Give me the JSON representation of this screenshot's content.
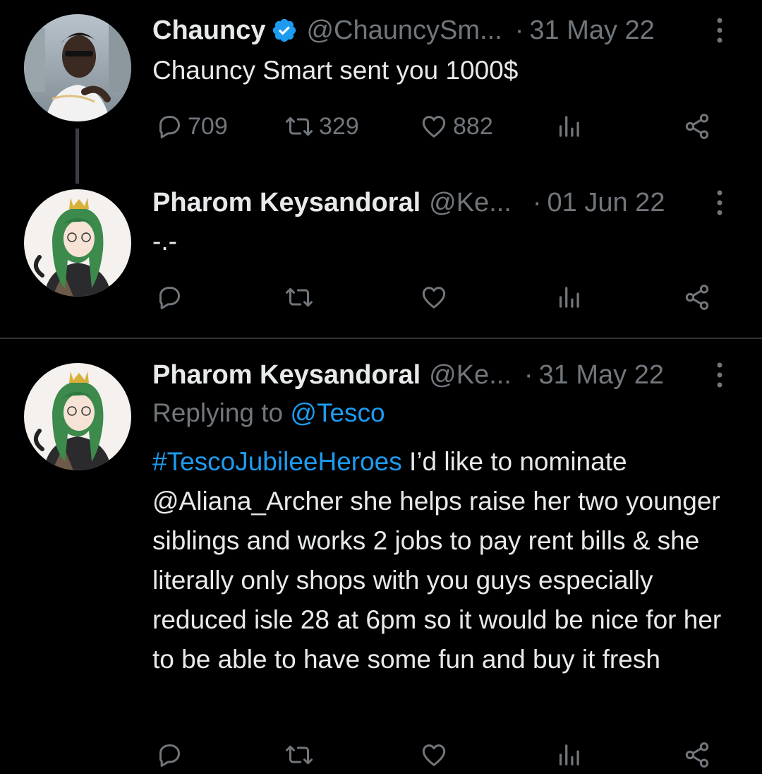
{
  "tweets": [
    {
      "name": "Chauncy",
      "verified": true,
      "handle": "@ChauncySm...",
      "date": "31 May 22",
      "text": "Chauncy Smart sent you 1000$",
      "replies": "709",
      "retweets": "329",
      "likes": "882"
    },
    {
      "name": "Pharom Keysandoral",
      "verified": false,
      "handle": "@Ke...",
      "date": "01 Jun 22",
      "text": "-.-",
      "replies": "",
      "retweets": "",
      "likes": ""
    },
    {
      "name": "Pharom Keysandoral",
      "verified": false,
      "handle": "@Ke...",
      "date": "31 May 22",
      "replying_prefix": "Replying to",
      "replying_to": "@Tesco",
      "hashtag": "#TescoJubileeHeroes",
      "text": " I’d like to nominate @Aliana_Archer she helps raise her two younger siblings and works 2 jobs to pay rent bills & she literally only shops with you guys especially reduced isle 28 at 6pm so it would be nice for her to be able to have some fun and buy it fresh"
    }
  ],
  "dot_separator": "·",
  "icons": {
    "reply": "speech-bubble-icon",
    "retweet": "retweet-arrows-icon",
    "like": "heart-icon",
    "views": "bar-chart-icon",
    "share": "share-nodes-icon",
    "more": "vertical-ellipsis-icon",
    "verified": "verified-badge-icon"
  },
  "colors": {
    "background": "#000000",
    "text": "#e7e9ea",
    "muted": "#71767b",
    "link": "#1d9bf0",
    "verified": "#1d9bf0",
    "divider": "#2f3336"
  }
}
